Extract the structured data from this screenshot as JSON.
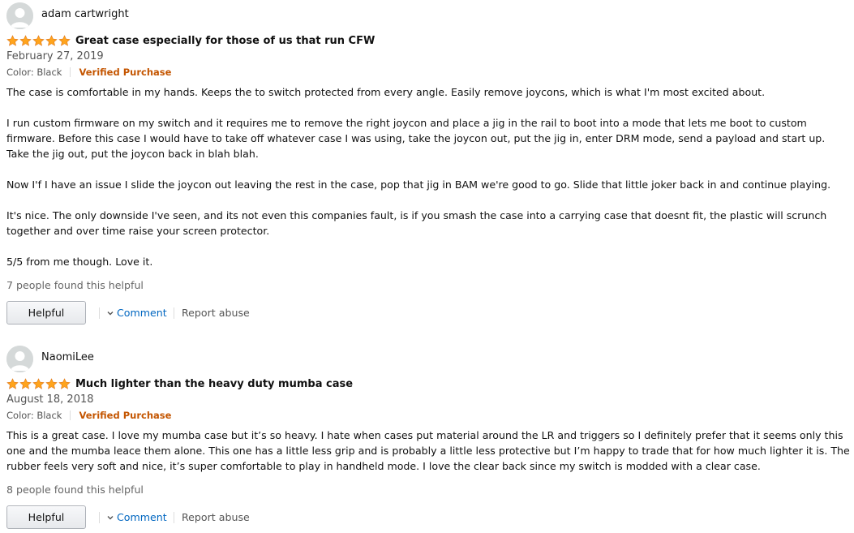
{
  "colors": {
    "star": "#ffa41c",
    "verified": "#c45500",
    "link": "#0066c0"
  },
  "icons": {
    "avatar": "default-user-avatar-icon",
    "star": "star-filled-icon",
    "comment": "chevron-down-icon"
  },
  "reviews": [
    {
      "username": "adam cartwright",
      "rating": 5,
      "title": "Great case especially for those of us that run CFW",
      "date": "February 27, 2019",
      "color_label": "Color: Black",
      "verified": "Verified Purchase",
      "paragraphs": [
        "The case is comfortable in my hands. Keeps the to switch protected from every angle. Easily remove joycons, which is what I'm most excited about.",
        "I run custom firmware on my switch and it requires me to remove the right joycon and place a jig in the rail to boot into a mode that lets me boot to custom firmware. Before this case I would have to take off whatever case I was using, take the joycon out, put the jig in, enter DRM mode, send a payload and start up. Take the jig out, put the joycon back in blah blah.",
        "Now I'f I have an issue I slide the joycon out leaving the rest in the case, pop that jig in BAM we're good to go. Slide that little joker back in and continue playing.",
        "It's nice. The only downside I've seen, and its not even this companies fault, is if you smash the case into a carrying case that doesnt fit, the plastic will scrunch together and over time raise your screen protector.",
        "5/5 from me though. Love it."
      ],
      "helpful_count": "7 people found this helpful",
      "helpful_button": "Helpful",
      "comment_label": "Comment",
      "report_label": "Report abuse"
    },
    {
      "username": "NaomiLee",
      "rating": 5,
      "title": "Much lighter than the heavy duty mumba case",
      "date": "August 18, 2018",
      "color_label": "Color: Black",
      "verified": "Verified Purchase",
      "paragraphs": [
        "This is a great case. I love my mumba case but it’s so heavy. I hate when cases put material around the LR and triggers so I definitely prefer that it seems only this one and the mumba leace them alone. This one has a little less grip and is probably a little less protective but I’m happy to trade that for how much lighter it is. The rubber feels very soft and nice, it’s super comfortable to play in handheld mode. I love the clear back since my switch is modded with a clear case."
      ],
      "helpful_count": "8 people found this helpful",
      "helpful_button": "Helpful",
      "comment_label": "Comment",
      "report_label": "Report abuse"
    }
  ]
}
